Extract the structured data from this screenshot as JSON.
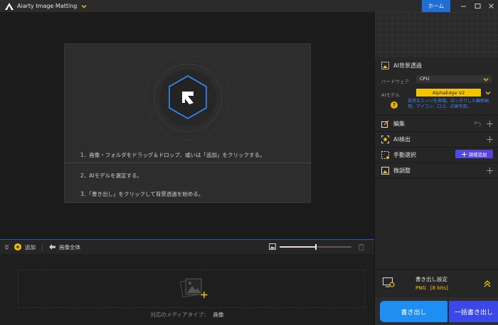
{
  "titlebar": {
    "app_title": "Aiarty Image Matting",
    "home_label": "ホーム"
  },
  "preview": {
    "steps": [
      "1．画像・フォルダをドラッグ＆ドロップ、或いは「追加」をクリックする。",
      "2．AIモデルを選定する。",
      "3．「書き出し」をクリックして背景透過を始める。"
    ]
  },
  "bottom_toolbar": {
    "add_label": "追加",
    "whole_image_label": "画像全体",
    "zoom_level": 0.5
  },
  "media": {
    "types_label": "対応のメディアタイプ：",
    "types_value": "画像"
  },
  "panel": {
    "ai_section": {
      "title": "AI背景透過",
      "hardware_label": "ハードウェア",
      "hardware_value": "CPU",
      "model_label": "AIモデル",
      "model_value": "AlphaEdge  V2",
      "model_desc": "自然なエッジを実現。はっきりした輪郭画用。アイコン、ロゴ、点画写真。",
      "help_glyph": "?"
    },
    "sections": {
      "edit": "編集",
      "ai_detect": "AI検出",
      "manual_select": "手動選択",
      "region_add": "領域追加",
      "fine_tune": "微調整"
    },
    "export": {
      "title": "書き出し設定",
      "format": "PNG",
      "bits": "[8 bits]",
      "export_label": "書き出し",
      "batch_label": "一括書き出し"
    }
  },
  "colors": {
    "accent_blue": "#1f6fd6",
    "highlight_yellow": "#f5c400",
    "export_blue": "#1f8ef3",
    "batch_indigo": "#3a48e8",
    "hex_outline": "#2f8fff"
  }
}
